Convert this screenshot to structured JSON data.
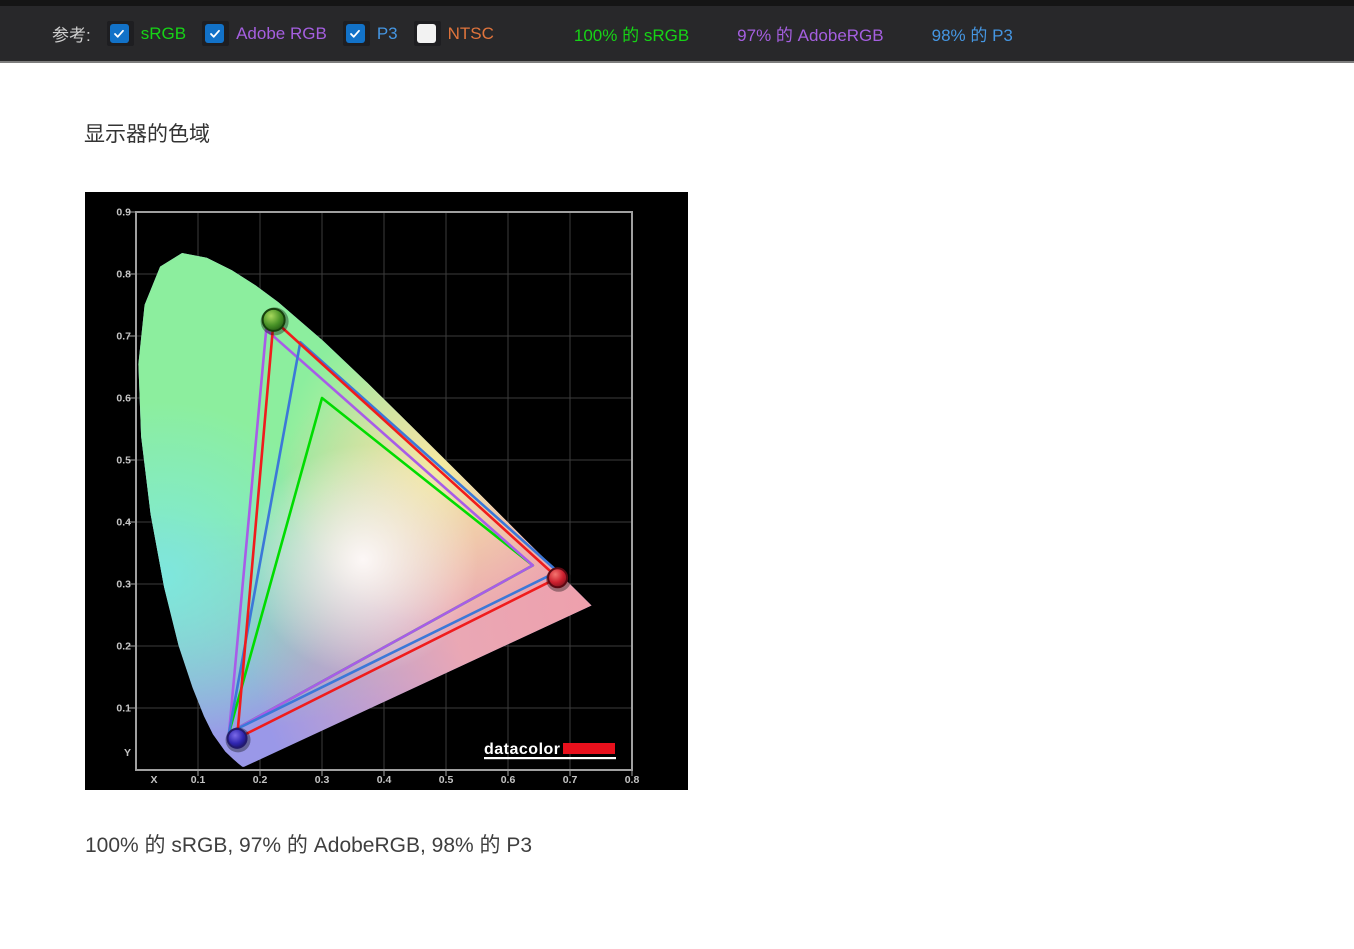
{
  "toolbar": {
    "ref_label": "参考:",
    "checkboxes": [
      {
        "id": "srgb",
        "label": "sRGB",
        "checked": true,
        "label_color": "#16d416"
      },
      {
        "id": "adobe-rgb",
        "label": "Adobe RGB",
        "checked": true,
        "label_color": "#a55fe0"
      },
      {
        "id": "p3",
        "label": "P3",
        "checked": true,
        "label_color": "#4596e2"
      },
      {
        "id": "ntsc",
        "label": "NTSC",
        "checked": false,
        "label_color": "#e0743c"
      }
    ],
    "results": [
      {
        "text": "100% 的 sRGB",
        "color": "#16d416"
      },
      {
        "text": "97% 的 AdobeRGB",
        "color": "#a55fe0"
      },
      {
        "text": "98% 的 P3",
        "color": "#4596e2"
      }
    ]
  },
  "page": {
    "title": "显示器的色域",
    "caption": "100% 的 sRGB, 97% 的 AdobeRGB, 98% 的 P3"
  },
  "chart_data": {
    "type": "scatter",
    "subtype": "CIE-1931-chromaticity-diagram",
    "xlabel": "X",
    "ylabel": "Y",
    "xlim": [
      0,
      0.8
    ],
    "ylim": [
      0,
      0.9
    ],
    "x_ticks": [
      "0.1",
      "0.2",
      "0.3",
      "0.4",
      "0.5",
      "0.6",
      "0.7",
      "0.8"
    ],
    "y_ticks": [
      "0.1",
      "0.2",
      "0.3",
      "0.4",
      "0.5",
      "0.6",
      "0.7",
      "0.8",
      "0.9"
    ],
    "grid": true,
    "watermark": "datacolor",
    "watermark_bar_color": "#e8101c",
    "series": [
      {
        "name": "sRGB",
        "color": "#00dc00",
        "points": [
          [
            0.64,
            0.33
          ],
          [
            0.3,
            0.6
          ],
          [
            0.15,
            0.06
          ]
        ]
      },
      {
        "name": "Adobe RGB",
        "color": "#a85ce8",
        "points": [
          [
            0.64,
            0.33
          ],
          [
            0.21,
            0.71
          ],
          [
            0.15,
            0.06
          ]
        ]
      },
      {
        "name": "P3",
        "color": "#3c78d8",
        "points": [
          [
            0.68,
            0.32
          ],
          [
            0.265,
            0.69
          ],
          [
            0.15,
            0.06
          ]
        ]
      },
      {
        "name": "display-gamut",
        "color": "#f01c1c",
        "points": [
          [
            0.68,
            0.31
          ],
          [
            0.222,
            0.726
          ],
          [
            0.163,
            0.051
          ]
        ],
        "markers": [
          "red-primary",
          "green-primary",
          "blue-primary"
        ]
      }
    ]
  }
}
